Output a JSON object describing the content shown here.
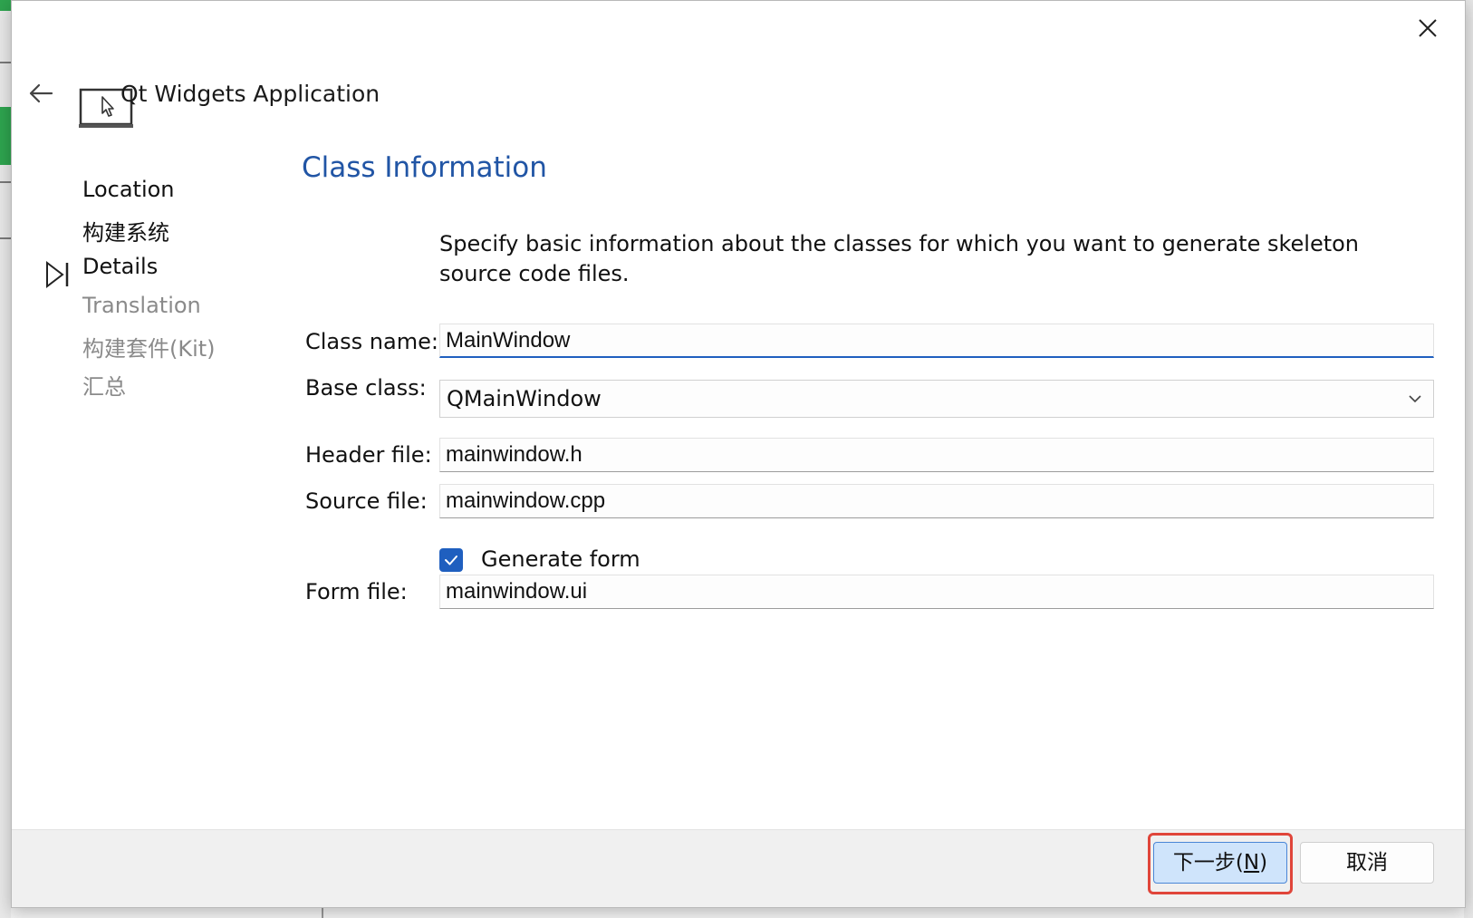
{
  "window": {
    "title": "Qt Widgets Application"
  },
  "nav": {
    "items": [
      {
        "label": "Location",
        "state": "done"
      },
      {
        "label": "构建系统",
        "state": "done"
      },
      {
        "label": "Details",
        "state": "current"
      },
      {
        "label": "Translation",
        "state": "pending"
      },
      {
        "label": "构建套件(Kit)",
        "state": "pending"
      },
      {
        "label": "汇总",
        "state": "pending"
      }
    ]
  },
  "page": {
    "section_title": "Class Information",
    "description": "Specify basic information about the classes for which you want to generate skeleton source code files."
  },
  "form": {
    "class_name_label": "Class name:",
    "class_name_value": "MainWindow",
    "base_class_label": "Base class:",
    "base_class_value": "QMainWindow",
    "header_file_label": "Header file:",
    "header_file_value": "mainwindow.h",
    "source_file_label": "Source file:",
    "source_file_value": "mainwindow.cpp",
    "generate_form_label": "Generate form",
    "generate_form_checked": true,
    "form_file_label": "Form file:",
    "form_file_value": "mainwindow.ui"
  },
  "footer": {
    "next_label_prefix": "下一步(",
    "next_label_mnemonic": "N",
    "next_label_suffix": ")",
    "cancel_label": "取消"
  },
  "colors": {
    "accent": "#1f5fbf",
    "section_title": "#2155a5",
    "highlight": "#e0453a"
  }
}
